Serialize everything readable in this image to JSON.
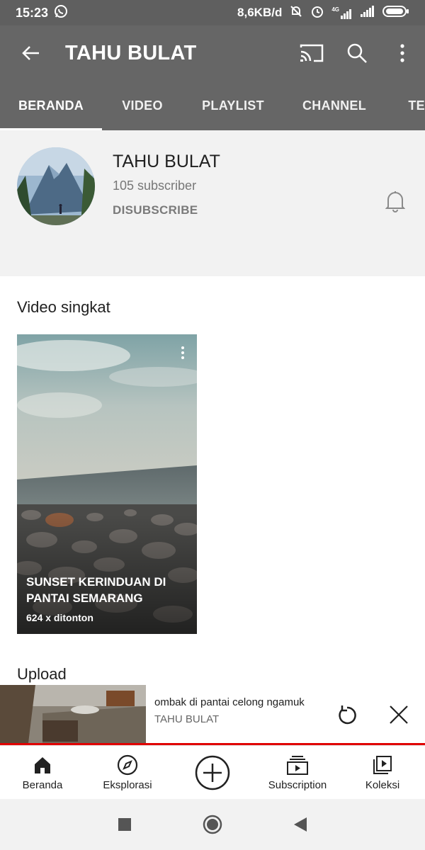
{
  "status_bar": {
    "time": "15:23",
    "network_speed": "8,6KB/d",
    "network_type": "4G",
    "icons": [
      "whatsapp-icon",
      "mute-icon",
      "alarm-icon",
      "signal-icon",
      "battery-icon"
    ]
  },
  "app_bar": {
    "title": "TAHU BULAT",
    "icons": [
      "back-arrow-icon",
      "cast-icon",
      "search-icon",
      "more-vert-icon"
    ]
  },
  "tabs": [
    {
      "label": "BERANDA",
      "active": true
    },
    {
      "label": "VIDEO",
      "active": false
    },
    {
      "label": "PLAYLIST",
      "active": false
    },
    {
      "label": "CHANNEL",
      "active": false
    },
    {
      "label": "TE",
      "active": false
    }
  ],
  "channel": {
    "name": "TAHU BULAT",
    "subscribers": "105 subscriber",
    "subscribe_action": "DISUBSCRIBE"
  },
  "shorts": {
    "section_title": "Video singkat",
    "items": [
      {
        "title": "SUNSET KERINDUAN DI PANTAI SEMARANG",
        "views": "624 x ditonton"
      }
    ]
  },
  "uploads": {
    "section_title": "Upload"
  },
  "mini_player": {
    "title": "ombak di pantai celong ngamuk",
    "channel": "TAHU BULAT"
  },
  "bottom_nav": [
    {
      "label": "Beranda",
      "icon": "home-icon"
    },
    {
      "label": "Eksplorasi",
      "icon": "compass-icon"
    },
    {
      "label": "",
      "icon": "add-icon"
    },
    {
      "label": "Subscription",
      "icon": "subscriptions-icon"
    },
    {
      "label": "Koleksi",
      "icon": "library-icon"
    }
  ],
  "colors": {
    "app_bar": "#666666",
    "status_bar": "#5f5f5f",
    "header_bg": "#f2f2f2",
    "progress": "#e00000"
  }
}
